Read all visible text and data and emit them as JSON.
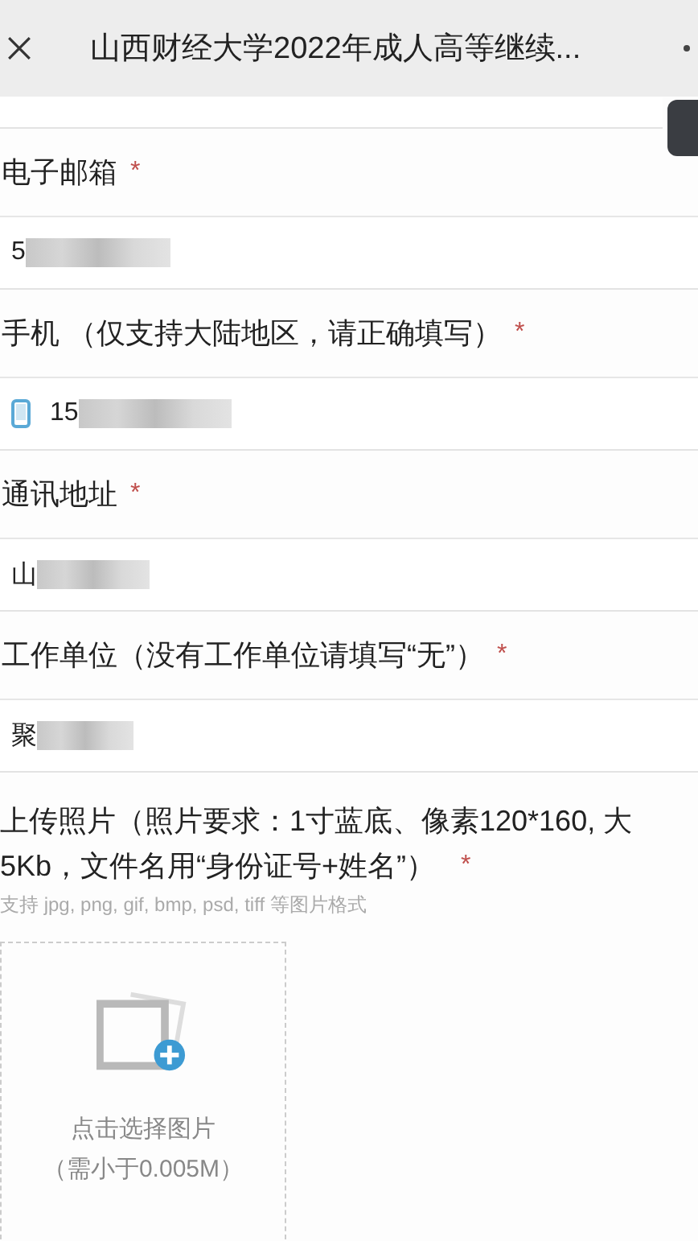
{
  "header": {
    "title": "山西财经大学2022年成人高等继续..."
  },
  "fields": [
    {
      "kind": "text",
      "label": "电子邮箱",
      "required_mark": "*",
      "value": "5"
    },
    {
      "kind": "phone",
      "label": "手机 （仅支持大陆地区，请正确填写）",
      "required_mark": "*",
      "value": "15"
    },
    {
      "kind": "text",
      "label": "通讯地址",
      "required_mark": "*",
      "value": "山"
    },
    {
      "kind": "text",
      "label": "工作单位（没有工作单位请填写“无”）",
      "required_mark": "*",
      "value": "聚"
    }
  ],
  "upload": {
    "label_lines": [
      "上传照片（照片要求：1寸蓝底、像素120*160, 大",
      "5Kb，文件名用“身份证号+姓名”）"
    ],
    "required_mark": "*",
    "hint": "支持 jpg, png, gif, bmp, psd, tiff 等图片格式",
    "button_lines": [
      "点击选择图片",
      "（需小于0.005M）"
    ]
  }
}
